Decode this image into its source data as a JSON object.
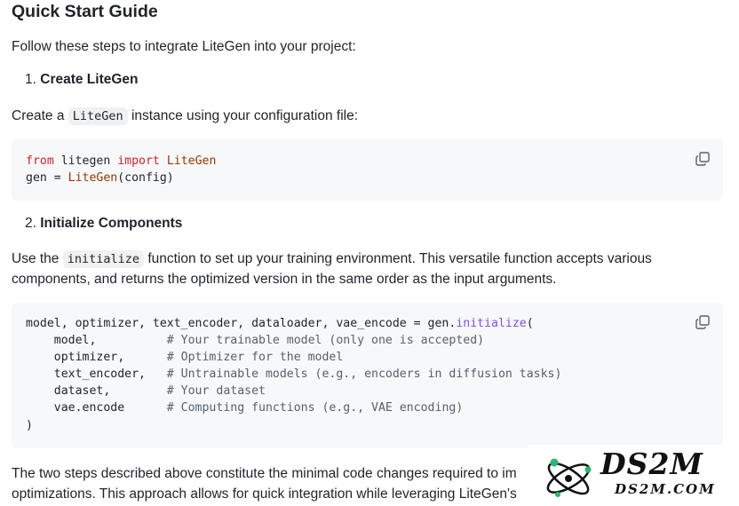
{
  "title": "Quick Start Guide",
  "intro": "Follow these steps to integrate LiteGen into your project:",
  "steps": [
    {
      "number": "1.",
      "heading": "Create LiteGen",
      "desc_before": "Create a",
      "desc_code": "LiteGen",
      "desc_after": "instance using your configuration file:"
    },
    {
      "number": "2.",
      "heading": "Initialize Components",
      "desc_before": "Use the",
      "desc_code": "initialize",
      "desc_after": "function to set up your training environment. This versatile function accepts various",
      "desc_line2": "components, and returns the optimized version in the same order as the input arguments."
    }
  ],
  "code1": {
    "l1_from": "from",
    "l1_module": " litegen ",
    "l1_import": "import",
    "l1_name": "LiteGen",
    "l2_var": "gen = ",
    "l2_call": "LiteGen",
    "l2_args": "(config)"
  },
  "code2": {
    "l1_pre": "model, optimizer, text_encoder, dataloader, vae_encode = gen.",
    "l1_fn": "initialize",
    "l1_post": "(",
    "args": [
      {
        "arg": "    model,          ",
        "comment": "# Your trainable model (only one is accepted)"
      },
      {
        "arg": "    optimizer,      ",
        "comment": "# Optimizer for the model"
      },
      {
        "arg": "    text_encoder,   ",
        "comment": "# Untrainable models (e.g., encoders in diffusion tasks)"
      },
      {
        "arg": "    dataset,        ",
        "comment": "# Your dataset"
      },
      {
        "arg": "    vae.encode      ",
        "comment": "# Computing functions (e.g., VAE encoding)"
      }
    ],
    "close": ")"
  },
  "outro_line1": "The two steps described above constitute the minimal code changes required to im",
  "outro_line2": "optimizations. This approach allows for quick integration while leveraging LiteGen's",
  "watermark": {
    "main": "DS2M",
    "sub": "DS2M.COM"
  }
}
